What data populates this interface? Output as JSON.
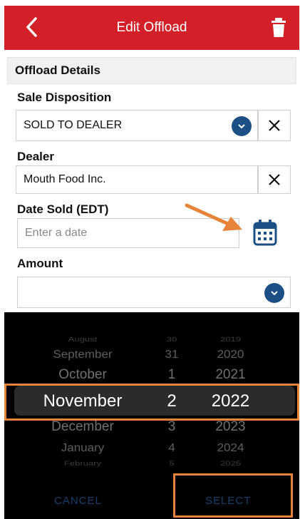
{
  "header": {
    "title": "Edit Offload"
  },
  "form": {
    "section_title": "Offload Details",
    "sale_disposition": {
      "label": "Sale Disposition",
      "value": "SOLD TO DEALER"
    },
    "dealer": {
      "label": "Dealer",
      "value": "Mouth Food Inc."
    },
    "date_sold": {
      "label": "Date Sold (EDT)",
      "placeholder": "Enter a date"
    },
    "amount": {
      "label": "Amount",
      "value": ""
    }
  },
  "picker": {
    "months": [
      "August",
      "September",
      "October",
      "November",
      "December",
      "January",
      "February"
    ],
    "days": [
      "30",
      "31",
      "1",
      "2",
      "3",
      "4",
      "5"
    ],
    "years": [
      "2019",
      "2020",
      "2021",
      "2022",
      "2023",
      "2024",
      "2025"
    ],
    "cancel_label": "CANCEL",
    "select_label": "SELECT"
  },
  "colors": {
    "header": "#d32028",
    "accent": "#1c4f86",
    "highlight": "#e8833a"
  }
}
